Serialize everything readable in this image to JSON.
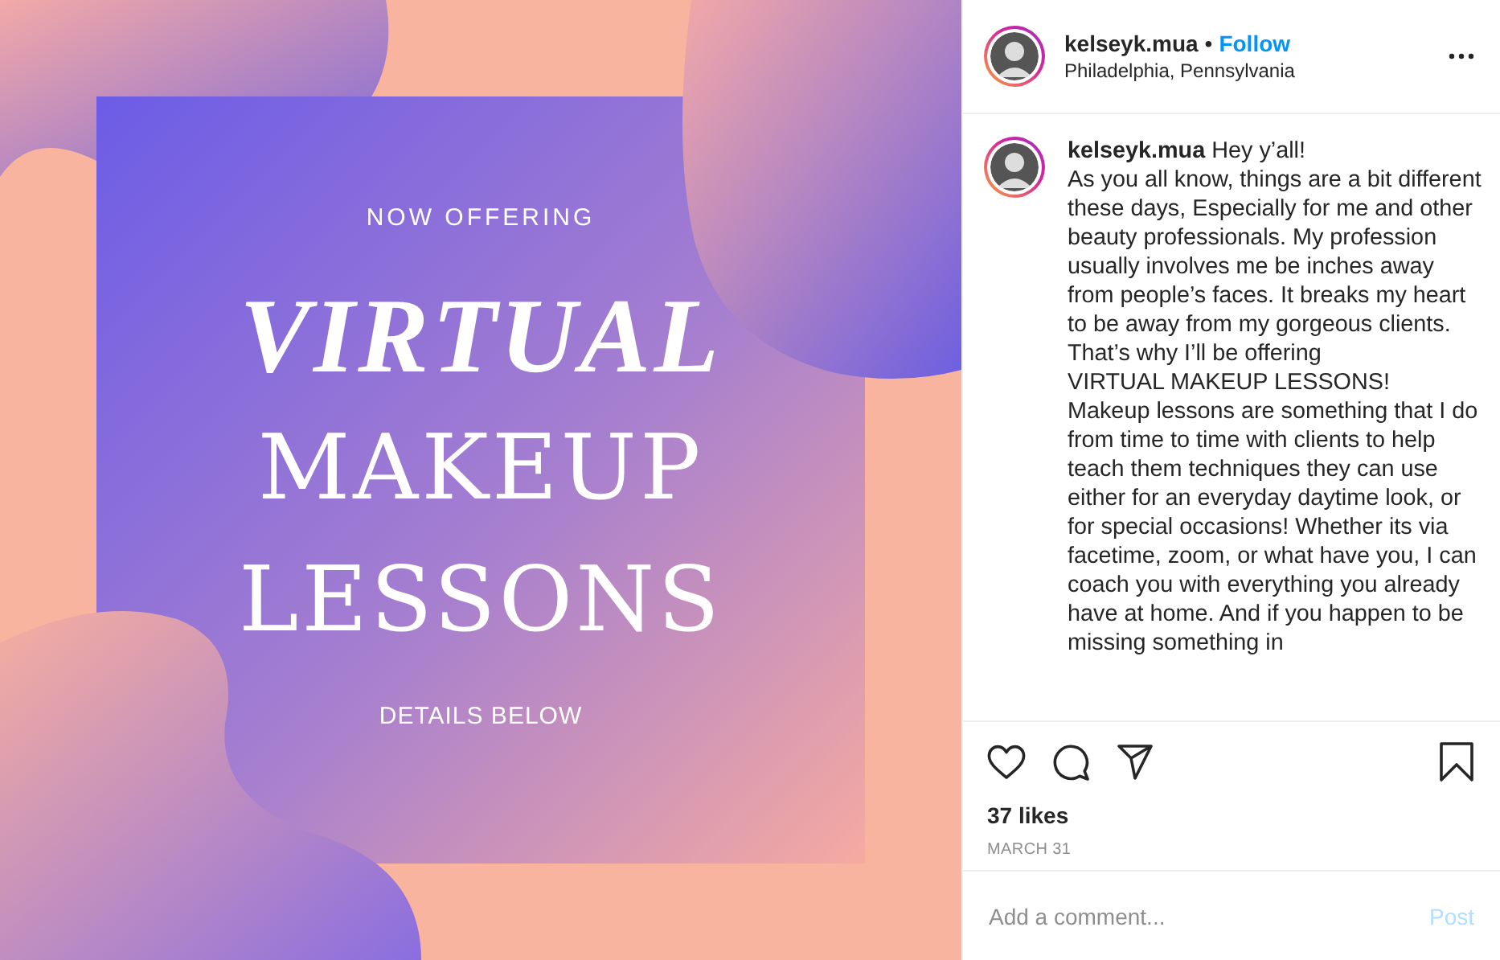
{
  "image": {
    "kind": "picture",
    "overline": "NOW OFFERING",
    "title_lines": [
      {
        "text": "VIRTUAL",
        "italic": true
      },
      {
        "text": "MAKEUP",
        "italic": false
      },
      {
        "text": "LESSONS",
        "italic": false
      }
    ],
    "footer": "DETAILS BELOW"
  },
  "header": {
    "username": "kelseyk.mua",
    "separator": "•",
    "follow": "Follow",
    "location": "Philadelphia, Pennsylvania"
  },
  "caption": {
    "username": "kelseyk.mua",
    "text": "Hey y’all!\nAs you all know, things are a bit different these days, Especially for me and other beauty professionals. My profession usually involves me be inches away from people’s faces. It breaks my heart to be away from my gorgeous clients. That’s why I’ll be offering\nVIRTUAL MAKEUP LESSONS!\nMakeup lessons are something that I do from time to time with clients to help teach them techniques they can use either for an everyday daytime look, or for special occasions! Whether its via facetime, zoom, or what have you, I can coach you with everything you already have at home. And if you happen to be missing something in"
  },
  "likes": "37 likes",
  "date": "MARCH 31",
  "comment": {
    "placeholder": "Add a comment...",
    "post": "Post",
    "post_disabled": true
  }
}
